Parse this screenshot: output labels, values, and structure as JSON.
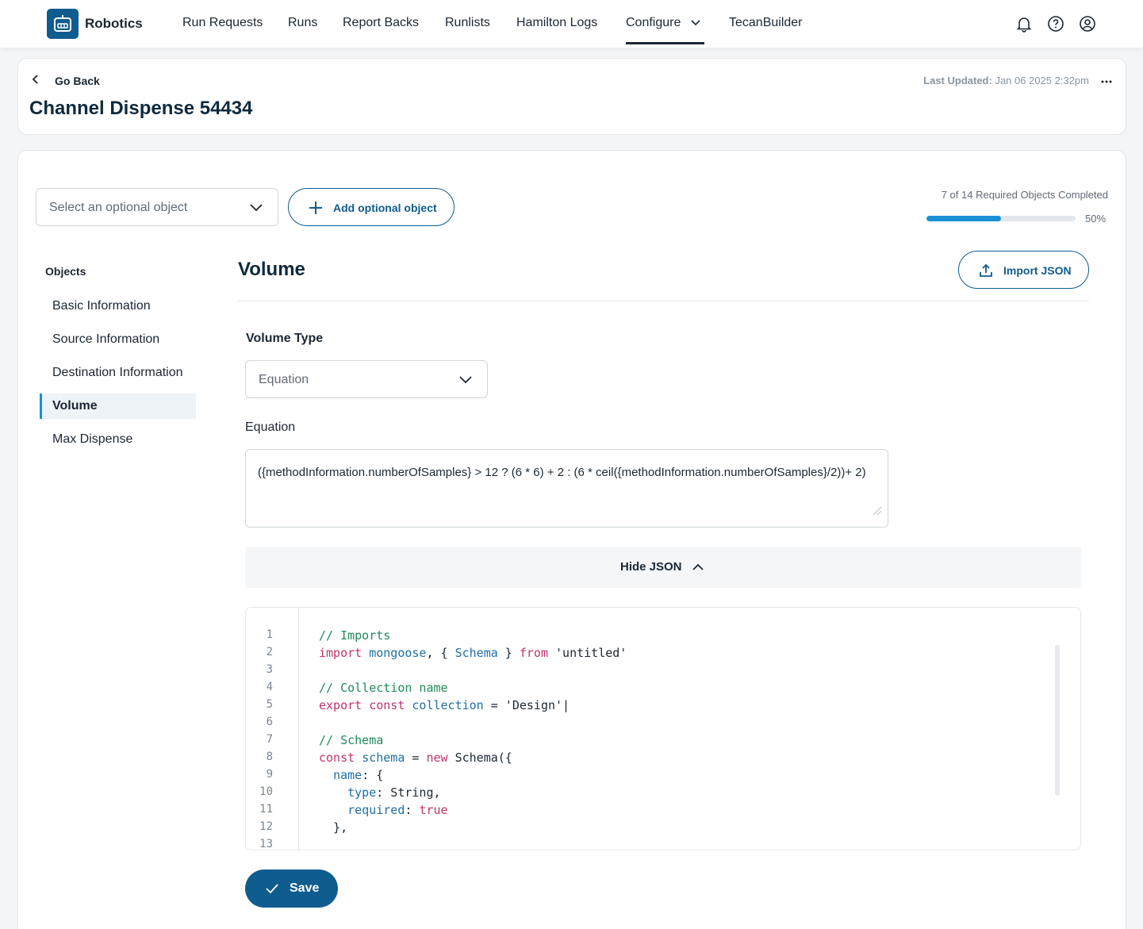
{
  "app": {
    "brand": "Robotics"
  },
  "nav": {
    "items": [
      "Run Requests",
      "Runs",
      "Report Backs",
      "Runlists",
      "Hamilton Logs",
      "Configure",
      "TecanBuilder"
    ],
    "active": "Configure"
  },
  "header": {
    "back_label": "Go Back",
    "title": "Channel Dispense 54434",
    "last_updated_label": "Last Updated:",
    "last_updated_value": "Jan 06 2025 2:32pm"
  },
  "toolbar": {
    "optional_select_placeholder": "Select an optional object",
    "add_optional_label": "Add optional object"
  },
  "progress": {
    "text": "7 of 14 Required Objects Completed",
    "percent_label": "50%",
    "value": 0.5
  },
  "sidebar": {
    "heading": "Objects",
    "items": [
      {
        "label": "Basic Information"
      },
      {
        "label": "Source Information"
      },
      {
        "label": "Destination Information"
      },
      {
        "label": "Volume"
      },
      {
        "label": "Max Dispense"
      }
    ],
    "active_index": 3
  },
  "section": {
    "title": "Volume",
    "import_label": "Import JSON",
    "volume_type_label": "Volume Type",
    "volume_type_value": "Equation",
    "equation_label": "Equation",
    "equation_value": "({methodInformation.numberOfSamples} > 12 ? (6 * 6) + 2 : (6 * ceil({methodInformation.numberOfSamples}/2))+ 2)",
    "hide_json_label": "Hide JSON",
    "save_label": "Save"
  },
  "code": {
    "line_numbers": [
      "1",
      "2",
      "3",
      "4",
      "5",
      "6",
      "7",
      "8",
      "9",
      "10",
      "11",
      "12",
      "13"
    ],
    "lines": [
      "// Imports",
      "import mongoose, { Schema } from 'untitled'",
      "",
      "// Collection name",
      "export const collection = 'Design'|",
      "",
      "// Schema",
      "const schema = new Schema({",
      "  name: {",
      "    type: String,",
      "    required: true",
      "  },",
      ""
    ]
  },
  "colors": {
    "brand": "#0f5c8f",
    "progress": "#1a8fd6",
    "comment": "#1f8a5b",
    "keyword": "#c2336f",
    "identifier": "#1f6fa5"
  },
  "icons": [
    "robot-logo-icon",
    "chevron-down-icon",
    "bell-icon",
    "help-icon",
    "user-icon",
    "chevron-left-icon",
    "more-horizontal-icon",
    "plus-icon",
    "upload-icon",
    "chevron-up-icon",
    "check-icon",
    "resize-grip-icon"
  ]
}
